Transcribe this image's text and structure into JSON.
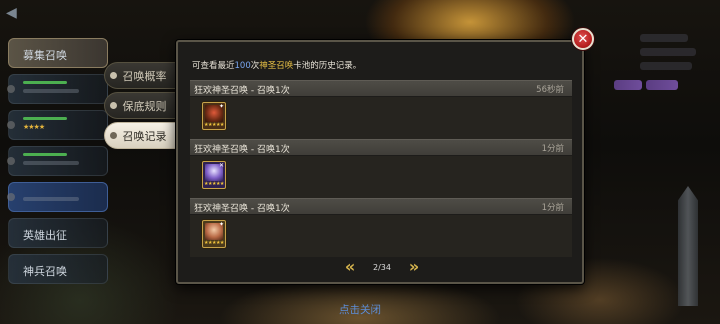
{
  "background_menu": {
    "items": [
      {
        "label": "募集召唤"
      },
      {
        "label": ""
      },
      {
        "label": ""
      },
      {
        "label": ""
      },
      {
        "label": ""
      },
      {
        "label": "英雄出征"
      },
      {
        "label": "神兵召唤"
      }
    ]
  },
  "tabs": [
    {
      "label": "召唤概率",
      "active": false
    },
    {
      "label": "保底规则",
      "active": false
    },
    {
      "label": "召唤记录",
      "active": true
    }
  ],
  "panel": {
    "header_prefix": "可查看最近",
    "header_count": "100",
    "header_mid": "次",
    "header_pool": "神圣召唤",
    "header_suffix": "卡池的历史记录。"
  },
  "records": [
    {
      "title": "狂欢神圣召唤 - 召唤1次",
      "time": "56秒前",
      "card_stars": "★★★★★"
    },
    {
      "title": "狂欢神圣召唤 - 召唤1次",
      "time": "1分前",
      "card_stars": "★★★★★"
    },
    {
      "title": "狂欢神圣召唤 - 召唤1次",
      "time": "1分前",
      "card_stars": "★★★★★"
    }
  ],
  "pager": {
    "text": "2/34",
    "prev_icon": "double-chevron-left-icon",
    "next_icon": "double-chevron-right-icon"
  },
  "close_button": {
    "icon": "close-icon",
    "symbol": "✕"
  },
  "tap_to_close": "点击关闭",
  "colors": {
    "accent_gold": "#e3bd45",
    "count_blue": "#7aa7f1",
    "close_red": "#c42424",
    "tap_close_blue": "#5d8ed9"
  }
}
